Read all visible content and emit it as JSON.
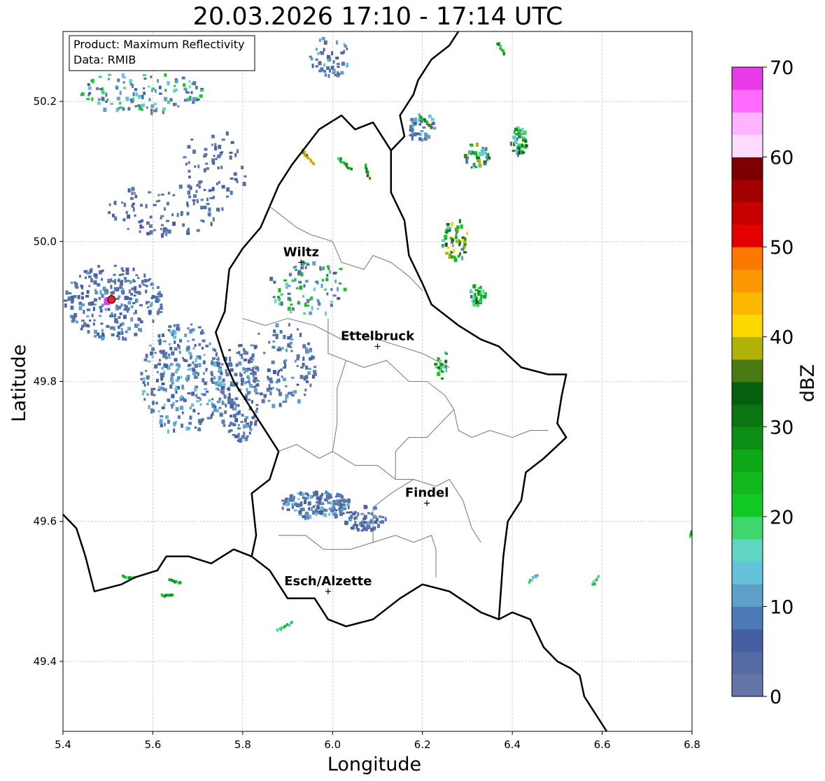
{
  "title": "20.03.2026 17:10 - 17:14 UTC",
  "info_box": [
    "Product: Maximum Reflectivity",
    "Data: RMIB"
  ],
  "axes": {
    "xlabel": "Longitude",
    "ylabel": "Latitude",
    "x_ticks": [
      "5.4",
      "5.6",
      "5.8",
      "6.0",
      "6.2",
      "6.4",
      "6.6",
      "6.8"
    ],
    "y_ticks": [
      "49.4",
      "49.6",
      "49.8",
      "50.0",
      "50.2"
    ],
    "xlim": [
      5.4,
      6.8
    ],
    "ylim": [
      49.3,
      50.3
    ],
    "grid": true
  },
  "cities": [
    {
      "name": "Wiltz",
      "lon": 5.93,
      "lat": 49.97
    },
    {
      "name": "Ettelbruck",
      "lon": 6.1,
      "lat": 49.85
    },
    {
      "name": "Findel",
      "lon": 6.21,
      "lat": 49.626
    },
    {
      "name": "Esch/Alzette",
      "lon": 5.99,
      "lat": 49.5
    }
  ],
  "radar_marker": {
    "lon": 5.505,
    "lat": 49.915,
    "color": "#e8222a"
  },
  "colorbar": {
    "label": "dBZ",
    "ticks": [
      "0",
      "10",
      "20",
      "30",
      "40",
      "50",
      "60",
      "70"
    ],
    "min": 0,
    "max": 70,
    "colors": [
      "#6475a8",
      "#566aa3",
      "#455fa2",
      "#4d7ab5",
      "#5ea0c8",
      "#66c2da",
      "#5fd5c2",
      "#3fd66e",
      "#13c925",
      "#12b81d",
      "#0ea719",
      "#0d8f16",
      "#0a7612",
      "#065f0d",
      "#4a7a14",
      "#b0b20a",
      "#fdd700",
      "#fdb700",
      "#fd9700",
      "#fd7800",
      "#e40000",
      "#c60000",
      "#a30000",
      "#7c0000",
      "#ffdcff",
      "#ffb2ff",
      "#ff6bff",
      "#e83ae8"
    ]
  },
  "borders": {
    "luxembourg": [
      [
        5.82,
        49.55
      ],
      [
        5.86,
        49.53
      ],
      [
        5.9,
        49.49
      ],
      [
        5.96,
        49.49
      ],
      [
        5.99,
        49.46
      ],
      [
        6.03,
        49.45
      ],
      [
        6.09,
        49.46
      ],
      [
        6.15,
        49.49
      ],
      [
        6.2,
        49.51
      ],
      [
        6.26,
        49.5
      ],
      [
        6.33,
        49.47
      ],
      [
        6.37,
        49.46
      ],
      [
        6.4,
        49.47
      ],
      [
        6.44,
        49.46
      ],
      [
        6.47,
        49.42
      ],
      [
        6.5,
        49.4
      ],
      [
        6.53,
        49.39
      ],
      [
        6.55,
        49.38
      ],
      [
        6.56,
        49.35
      ],
      [
        6.58,
        49.33
      ],
      [
        6.6,
        49.31
      ],
      [
        6.62,
        49.29
      ]
    ],
    "lu_de": [
      [
        5.82,
        49.55
      ],
      [
        5.83,
        49.58
      ],
      [
        5.82,
        49.64
      ],
      [
        5.86,
        49.66
      ],
      [
        5.88,
        49.7
      ],
      [
        5.86,
        49.72
      ],
      [
        5.82,
        49.76
      ],
      [
        5.78,
        49.8
      ],
      [
        5.76,
        49.83
      ],
      [
        5.74,
        49.87
      ],
      [
        5.76,
        49.9
      ],
      [
        5.77,
        49.96
      ],
      [
        5.8,
        49.99
      ],
      [
        5.84,
        50.02
      ],
      [
        5.86,
        50.05
      ],
      [
        5.88,
        50.08
      ],
      [
        5.91,
        50.11
      ],
      [
        5.97,
        50.16
      ],
      [
        6.02,
        50.18
      ],
      [
        6.05,
        50.16
      ],
      [
        6.09,
        50.17
      ],
      [
        6.13,
        50.13
      ],
      [
        6.13,
        50.07
      ],
      [
        6.16,
        50.03
      ],
      [
        6.17,
        49.98
      ],
      [
        6.2,
        49.94
      ],
      [
        6.22,
        49.91
      ],
      [
        6.28,
        49.88
      ],
      [
        6.33,
        49.86
      ],
      [
        6.37,
        49.85
      ],
      [
        6.42,
        49.82
      ],
      [
        6.48,
        49.81
      ],
      [
        6.52,
        49.81
      ],
      [
        6.51,
        49.78
      ],
      [
        6.5,
        49.74
      ],
      [
        6.52,
        49.72
      ],
      [
        6.47,
        49.69
      ],
      [
        6.43,
        49.67
      ],
      [
        6.42,
        49.63
      ],
      [
        6.39,
        49.6
      ],
      [
        6.38,
        49.55
      ],
      [
        6.37,
        49.46
      ]
    ],
    "be_fr": [
      [
        5.4,
        49.61
      ],
      [
        5.43,
        49.59
      ],
      [
        5.45,
        49.55
      ],
      [
        5.47,
        49.5
      ],
      [
        5.53,
        49.51
      ],
      [
        5.56,
        49.52
      ],
      [
        5.61,
        49.53
      ],
      [
        5.63,
        49.55
      ],
      [
        5.68,
        49.55
      ],
      [
        5.73,
        49.54
      ],
      [
        5.78,
        49.56
      ],
      [
        5.82,
        49.55
      ]
    ],
    "de_top": [
      [
        6.13,
        50.13
      ],
      [
        6.16,
        50.15
      ],
      [
        6.15,
        50.18
      ],
      [
        6.18,
        50.21
      ],
      [
        6.19,
        50.23
      ],
      [
        6.22,
        50.26
      ],
      [
        6.26,
        50.28
      ],
      [
        6.28,
        50.3
      ]
    ],
    "lu_inner": [
      [
        [
          5.86,
          50.05
        ],
        [
          5.92,
          50.02
        ],
        [
          5.95,
          50.01
        ],
        [
          6.0,
          50.0
        ],
        [
          6.02,
          49.97
        ],
        [
          6.07,
          49.96
        ],
        [
          6.09,
          49.98
        ],
        [
          6.13,
          49.97
        ],
        [
          6.17,
          49.95
        ],
        [
          6.2,
          49.93
        ]
      ],
      [
        [
          5.8,
          49.89
        ],
        [
          5.85,
          49.88
        ],
        [
          5.9,
          49.89
        ],
        [
          5.96,
          49.88
        ],
        [
          6.02,
          49.86
        ],
        [
          6.05,
          49.87
        ],
        [
          6.1,
          49.86
        ],
        [
          6.15,
          49.85
        ],
        [
          6.2,
          49.84
        ],
        [
          6.26,
          49.82
        ]
      ],
      [
        [
          5.99,
          49.89
        ],
        [
          5.99,
          49.84
        ],
        [
          6.03,
          49.83
        ],
        [
          6.07,
          49.82
        ],
        [
          6.12,
          49.83
        ],
        [
          6.17,
          49.8
        ],
        [
          6.21,
          49.8
        ],
        [
          6.25,
          49.78
        ],
        [
          6.27,
          49.76
        ],
        [
          6.28,
          49.73
        ],
        [
          6.31,
          49.72
        ],
        [
          6.35,
          49.73
        ],
        [
          6.4,
          49.72
        ],
        [
          6.44,
          49.73
        ],
        [
          6.48,
          49.73
        ]
      ],
      [
        [
          6.03,
          49.83
        ],
        [
          6.01,
          49.79
        ],
        [
          6.01,
          49.74
        ],
        [
          6.0,
          49.7
        ],
        [
          5.97,
          49.69
        ],
        [
          5.92,
          49.71
        ],
        [
          5.88,
          49.7
        ]
      ],
      [
        [
          6.0,
          49.7
        ],
        [
          6.05,
          49.68
        ],
        [
          6.1,
          49.68
        ],
        [
          6.14,
          49.66
        ],
        [
          6.18,
          49.66
        ],
        [
          6.23,
          49.65
        ],
        [
          6.26,
          49.66
        ],
        [
          6.29,
          49.63
        ],
        [
          6.31,
          49.59
        ],
        [
          6.33,
          49.57
        ]
      ],
      [
        [
          6.27,
          49.76
        ],
        [
          6.24,
          49.74
        ],
        [
          6.21,
          49.72
        ],
        [
          6.17,
          49.72
        ],
        [
          6.14,
          49.7
        ],
        [
          6.14,
          49.66
        ]
      ],
      [
        [
          5.88,
          49.58
        ],
        [
          5.94,
          49.58
        ],
        [
          5.98,
          49.56
        ],
        [
          6.04,
          49.56
        ],
        [
          6.09,
          49.57
        ],
        [
          6.14,
          49.58
        ],
        [
          6.18,
          49.57
        ],
        [
          6.22,
          49.58
        ],
        [
          6.23,
          49.56
        ],
        [
          6.23,
          49.52
        ]
      ],
      [
        [
          6.09,
          49.57
        ],
        [
          6.09,
          49.62
        ],
        [
          6.13,
          49.64
        ],
        [
          6.18,
          49.66
        ]
      ]
    ]
  }
}
